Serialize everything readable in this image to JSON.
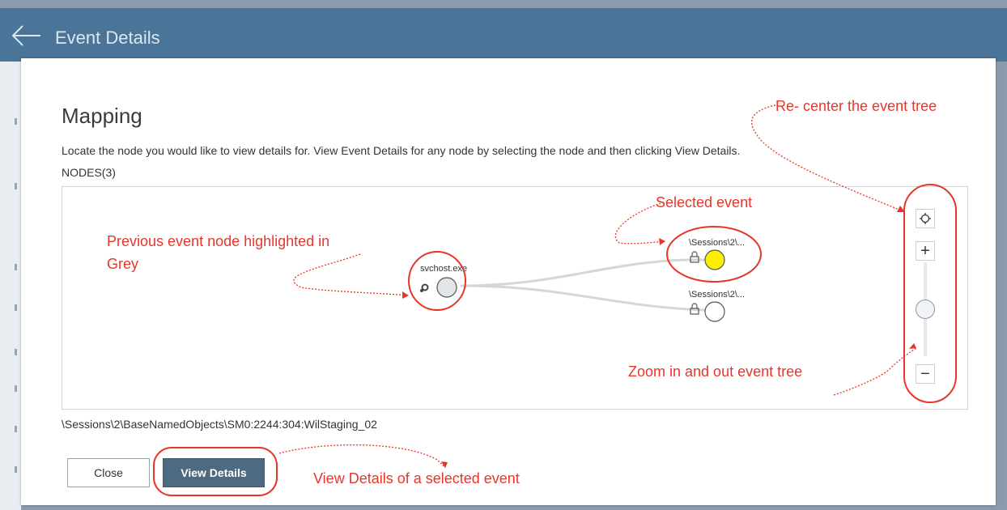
{
  "header": {
    "title": "Event Details",
    "back_icon": "arrow-left-icon"
  },
  "dialog": {
    "title": "Mapping",
    "description": "Locate the node you would like to view details for. View Event Details for any node by selecting the node and then clicking View Details.",
    "nodes_label": "NODES(3)",
    "selected_path": "\\Sessions\\2\\BaseNamedObjects\\SM0:2244:304:WilStaging_02",
    "buttons": {
      "close": "Close",
      "view_details": "View Details"
    }
  },
  "graph": {
    "nodes": [
      {
        "label": "svchost.exe",
        "icon": "gear-icon",
        "state": "previous",
        "fill": "#e2e5e8"
      },
      {
        "label": "\\Sessions\\2\\...",
        "icon": "lock-icon",
        "state": "selected",
        "fill": "#ffee00"
      },
      {
        "label": "\\Sessions\\2\\...",
        "icon": "lock-icon",
        "state": "normal",
        "fill": "#ffffff"
      }
    ]
  },
  "zoom": {
    "recenter_icon": "crosshair-icon",
    "plus_symbol": "+",
    "minus_symbol": "−",
    "level": 0.5
  },
  "annotations": {
    "recenter": "Re- center the event tree",
    "selected": "Selected event",
    "previous_line1": "Previous event node highlighted in",
    "previous_line2": "Grey",
    "zoom": "Zoom in and out event tree",
    "view_details": "View Details of a selected event",
    "color": "#e8352a"
  },
  "colors": {
    "header_bg": "#4a7599",
    "button_primary": "#4e6a80",
    "selected_node": "#ffee00"
  }
}
